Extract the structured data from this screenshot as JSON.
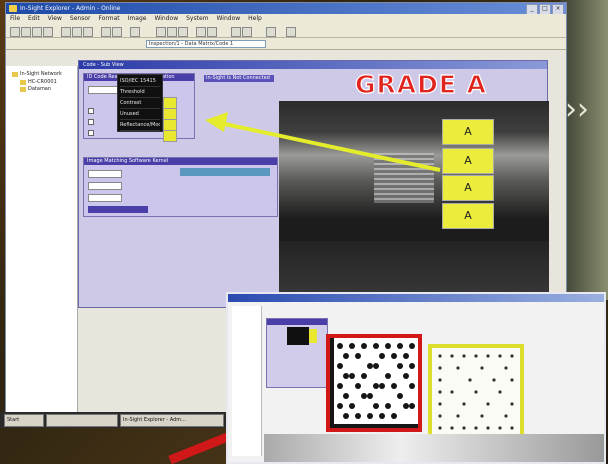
{
  "window": {
    "title": "In-Sight Explorer - Admin - Online",
    "controls": [
      "_",
      "□",
      "×"
    ]
  },
  "menu": [
    "File",
    "Edit",
    "View",
    "Sensor",
    "Format",
    "Image",
    "Window",
    "System",
    "Window",
    "Help"
  ],
  "address": {
    "value": "Inspection/1 - Data Matrix/Code 1"
  },
  "tree": {
    "items": [
      "In-Sight Network",
      "HC-CR0001",
      "Dataman"
    ]
  },
  "child_window": {
    "title": "Code - Sub View",
    "settings_panel": {
      "header": "ID Code Reader Grade & Validation"
    },
    "view_tab": "In-Sight Is Not Connected",
    "dropdown_items": [
      "ISO/IEC 15415",
      "Threshold",
      "Contrast",
      "Unused",
      "Reflectance/Mod"
    ],
    "match_panel": {
      "header": "Image Matching Software Kernel"
    }
  },
  "overlay": {
    "grade_text": "GRADE A",
    "badges": [
      "A",
      "A",
      "A",
      "A"
    ],
    "colors": {
      "grade_red": "#e0231c",
      "badge_yellow": "#ecec3c",
      "arrow_yellow": "#e4ec2c",
      "arrow_red": "#d01818"
    }
  },
  "taskbar": {
    "items": [
      "Start",
      "",
      "In-Sight Explorer - Adm..."
    ]
  }
}
